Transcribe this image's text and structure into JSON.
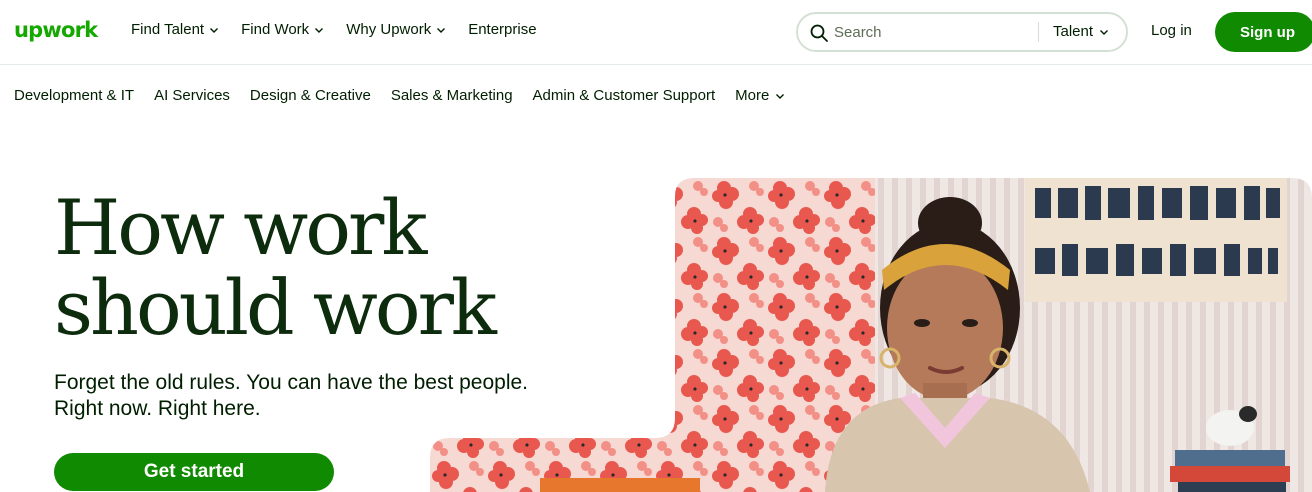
{
  "brand": {
    "logo_text": "upwork",
    "accent": "#14a800",
    "button_green": "#108a00"
  },
  "nav": {
    "items": [
      {
        "label": "Find Talent",
        "has_dropdown": true
      },
      {
        "label": "Find Work",
        "has_dropdown": true
      },
      {
        "label": "Why Upwork",
        "has_dropdown": true
      },
      {
        "label": "Enterprise",
        "has_dropdown": false
      }
    ]
  },
  "search": {
    "placeholder": "Search",
    "scope": "Talent",
    "icon": "search-icon"
  },
  "auth": {
    "login": "Log in",
    "signup": "Sign up"
  },
  "categories": [
    {
      "label": "Development & IT"
    },
    {
      "label": "AI Services"
    },
    {
      "label": "Design & Creative"
    },
    {
      "label": "Sales & Marketing"
    },
    {
      "label": "Admin & Customer Support"
    },
    {
      "label": "More",
      "has_dropdown": true
    }
  ],
  "hero": {
    "headline": [
      "How work",
      "should work"
    ],
    "subtext": [
      "Forget the old rules. You can have the best people.",
      "Right now. Right here."
    ],
    "cta": "Get started"
  }
}
